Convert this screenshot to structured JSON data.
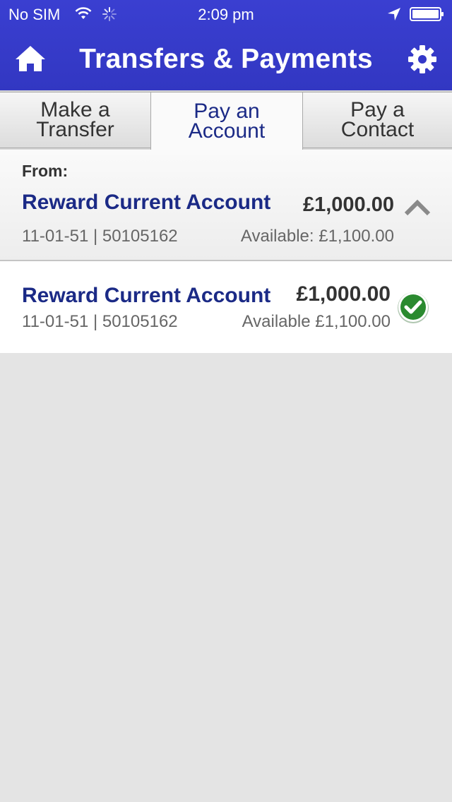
{
  "status_bar": {
    "carrier": "No SIM",
    "time": "2:09 pm",
    "icons": [
      "wifi-icon",
      "activity-icon",
      "location-icon",
      "battery-icon"
    ]
  },
  "nav": {
    "title": "Transfers & Payments",
    "left_icon": "home-icon",
    "right_icon": "gear-icon"
  },
  "tabs": [
    {
      "line1": "Make a",
      "line2": "Transfer"
    },
    {
      "line1": "Pay an",
      "line2": "Account"
    },
    {
      "line1": "Pay a",
      "line2": "Contact"
    }
  ],
  "from": {
    "label": "From:",
    "account_name": "Reward Current Account",
    "balance": "£1,000.00",
    "sort_account": "11-01-51 | 50105162",
    "available": "Available: £1,100.00"
  },
  "accounts": [
    {
      "name": "Reward Current Account",
      "balance": "£1,000.00",
      "sort_account": "11-01-51 | 50105162",
      "available": "Available £1,100.00"
    }
  ],
  "colors": {
    "header": "#3a3fd1",
    "account_name": "#1b2a86",
    "check": "#2a8a2f"
  }
}
